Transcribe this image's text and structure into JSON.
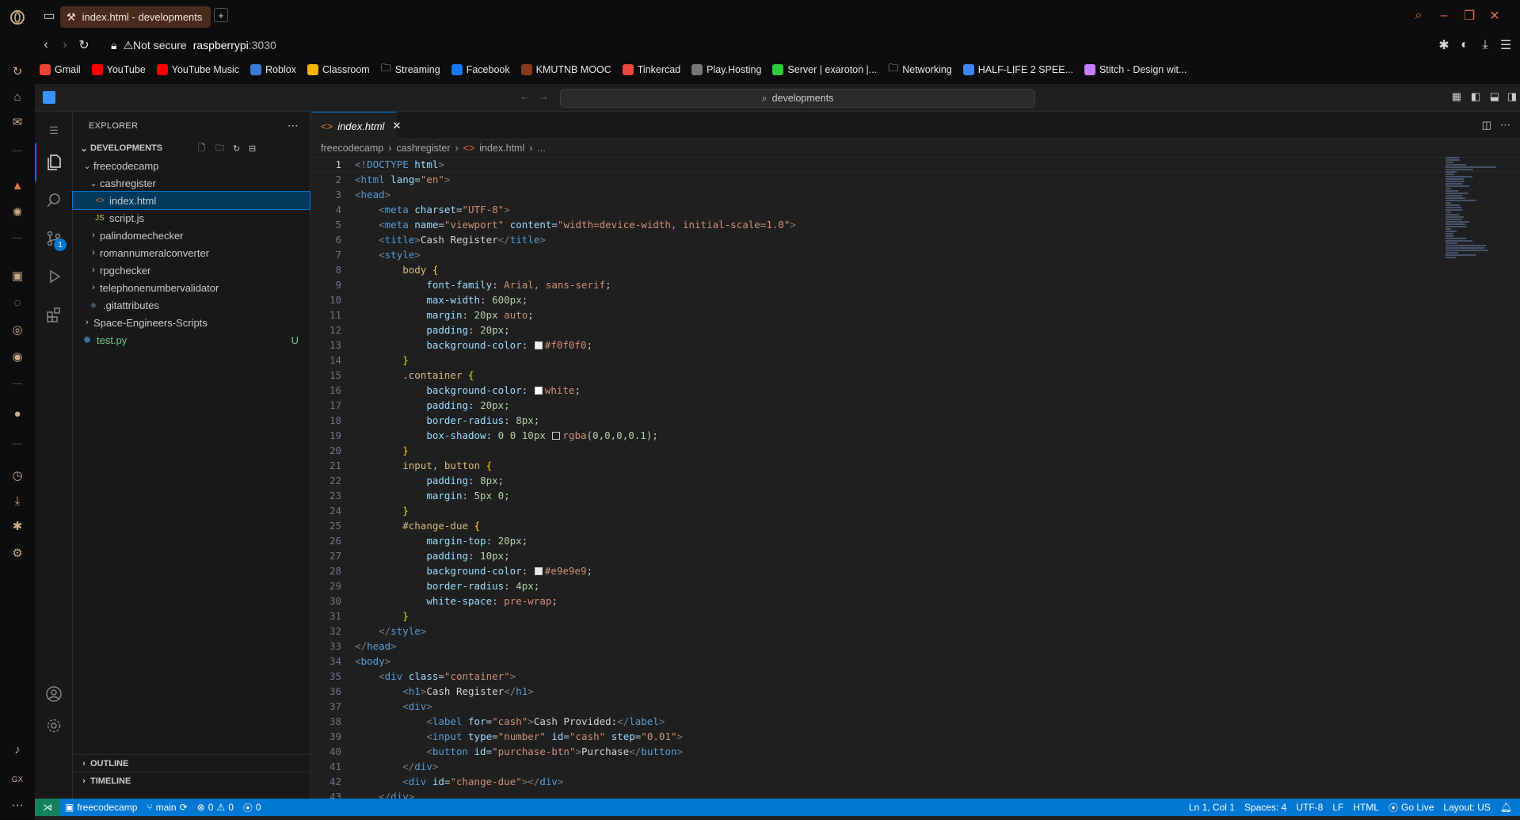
{
  "browser": {
    "tab_title": "index.html - developments",
    "url_warning": "Not secure",
    "url_host": "raspberrypi",
    "url_port": ":3030"
  },
  "bookmarks": [
    {
      "label": "Gmail",
      "color": "#ea4335"
    },
    {
      "label": "YouTube",
      "color": "#ff0000"
    },
    {
      "label": "YouTube Music",
      "color": "#ff0000"
    },
    {
      "label": "Roblox",
      "color": "#3a7bd5"
    },
    {
      "label": "Classroom",
      "color": "#f4b400"
    },
    {
      "label": "Streaming",
      "color": "folder"
    },
    {
      "label": "Facebook",
      "color": "#1877f2"
    },
    {
      "label": "KMUTNB MOOC",
      "color": "#8a3a1a"
    },
    {
      "label": "Tinkercad",
      "color": "#e8493a"
    },
    {
      "label": "Play.Hosting",
      "color": "#777777"
    },
    {
      "label": "Server | exaroton |...",
      "color": "#2ecc40"
    },
    {
      "label": "Networking",
      "color": "folder"
    },
    {
      "label": "HALF-LIFE 2 SPEE...",
      "color": "#4285f4"
    },
    {
      "label": "Stitch - Design wit...",
      "color": "#c77dff"
    }
  ],
  "vscode": {
    "command_center": "developments",
    "explorer_title": "EXPLORER",
    "workspace": "DEVELOPMENTS",
    "scm_badge": "1",
    "tree": [
      {
        "label": "freecodecamp",
        "depth": 1,
        "kind": "folder-open"
      },
      {
        "label": "cashregister",
        "depth": 2,
        "kind": "folder-open"
      },
      {
        "label": "index.html",
        "depth": 3,
        "kind": "html",
        "selected": true
      },
      {
        "label": "script.js",
        "depth": 3,
        "kind": "js"
      },
      {
        "label": "palindomechecker",
        "depth": 2,
        "kind": "folder"
      },
      {
        "label": "romannumeralconverter",
        "depth": 2,
        "kind": "folder"
      },
      {
        "label": "rpgchecker",
        "depth": 2,
        "kind": "folder"
      },
      {
        "label": "telephonenumbervalidator",
        "depth": 2,
        "kind": "folder"
      },
      {
        "label": ".gitattributes",
        "depth": 2,
        "kind": "git"
      },
      {
        "label": "Space-Engineers-Scripts",
        "depth": 1,
        "kind": "folder"
      },
      {
        "label": "test.py",
        "depth": 1,
        "kind": "py",
        "status": "U"
      }
    ],
    "outline_label": "OUTLINE",
    "timeline_label": "TIMELINE",
    "editor_tab": "index.html",
    "breadcrumb": [
      "freecodecamp",
      "cashregister",
      "index.html",
      "..."
    ],
    "status": {
      "branch_folder": "freecodecamp",
      "branch": "main",
      "errors": "0",
      "warnings": "0",
      "ports": "0",
      "position": "Ln 1, Col 1",
      "spaces": "Spaces: 4",
      "encoding": "UTF-8",
      "eol": "LF",
      "language": "HTML",
      "golive": "Go Live",
      "layout": "Layout: US"
    }
  },
  "code_lines": [
    "1",
    "2",
    "3",
    "4",
    "5",
    "6",
    "7",
    "8",
    "9",
    "10",
    "11",
    "12",
    "13",
    "14",
    "15",
    "16",
    "17",
    "18",
    "19",
    "20",
    "21",
    "22",
    "23",
    "24",
    "25",
    "26",
    "27",
    "28",
    "29",
    "30",
    "31",
    "32",
    "33",
    "34",
    "35",
    "36",
    "37",
    "38",
    "39",
    "40",
    "41",
    "42",
    "43"
  ]
}
